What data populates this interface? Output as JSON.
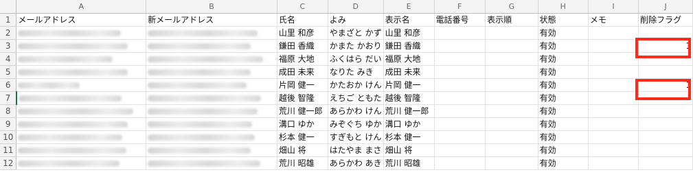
{
  "columns": [
    "",
    "A",
    "B",
    "C",
    "D",
    "E",
    "F",
    "G",
    "H",
    "I",
    "J"
  ],
  "header_row": {
    "row_number": "1",
    "cells": [
      "メールアドレス",
      "新メールアドレス",
      "氏名",
      "よみ",
      "表示名",
      "電話番号",
      "表示順",
      "状態",
      "メモ",
      "削除フラグ"
    ]
  },
  "rows": [
    {
      "n": "2",
      "name": "山里 和彦",
      "yomi": "やまざと かず",
      "display": "山里 和彦",
      "status": "有効",
      "flag": ""
    },
    {
      "n": "3",
      "name": "鎌田 香織",
      "yomi": "かまた かおり",
      "display": "鎌田 香織",
      "status": "有効",
      "flag": "1"
    },
    {
      "n": "4",
      "name": "福原 大地",
      "yomi": "ふくはら だい",
      "display": "福原 大地",
      "status": "有効",
      "flag": ""
    },
    {
      "n": "5",
      "name": "成田 未来",
      "yomi": "なりた みき",
      "display": "成田 未来",
      "status": "有効",
      "flag": ""
    },
    {
      "n": "6",
      "name": "片岡 健一",
      "yomi": "かたおか けん",
      "display": "片岡 健一",
      "status": "有効",
      "flag": "1"
    },
    {
      "n": "7",
      "name": "越後 智隆",
      "yomi": "えちご ともた",
      "display": "越後 智隆",
      "status": "有効",
      "flag": ""
    },
    {
      "n": "8",
      "name": "荒川 健一郎",
      "yomi": "あらかわ けん",
      "display": "荒川 健一郎",
      "status": "有効",
      "flag": ""
    },
    {
      "n": "9",
      "name": "溝口 ゆか",
      "yomi": "みぞぐち ゆか",
      "display": "溝口 ゆか",
      "status": "有効",
      "flag": ""
    },
    {
      "n": "10",
      "name": "杉本 健一",
      "yomi": "すぎもと けん",
      "display": "杉本 健一",
      "status": "有効",
      "flag": ""
    },
    {
      "n": "11",
      "name": "畑山 将",
      "yomi": "はたやま まさ",
      "display": "畑山 将",
      "status": "有効",
      "flag": ""
    },
    {
      "n": "12",
      "name": "荒川 昭雄",
      "yomi": "あらかわ あき",
      "display": "荒川 昭雄",
      "status": "有効",
      "flag": ""
    }
  ],
  "highlight_color": "#ff2a17",
  "selection_color": "#217346"
}
